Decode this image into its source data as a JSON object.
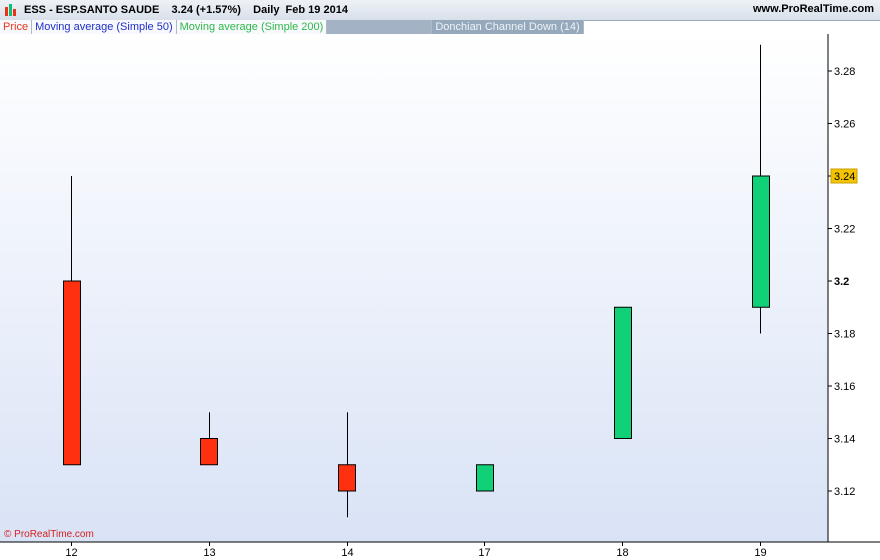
{
  "header": {
    "title": "ESS - ESP.SANTO SAUDE    3.24 (+1.57%)    Daily  Feb 19 2014",
    "site": "www.ProRealTime.com"
  },
  "legend": [
    {
      "label": "Price",
      "color": "#e8341c"
    },
    {
      "label": "Moving average (Simple 50)",
      "color": "#1f2fc8"
    },
    {
      "label": "Moving average (Simple 200)",
      "color": "#2fb84a"
    },
    {
      "label": "Donchian Channel Down (14)",
      "color": "#eef3f8"
    }
  ],
  "watermark": "© ProRealTime.com",
  "last_price_label": "3.24",
  "colors": {
    "up": "#10d078",
    "down": "#ff3010",
    "badge": "#f4c400"
  },
  "chart_data": {
    "type": "candlestick",
    "title": "",
    "xlabel": "",
    "ylabel": "",
    "x_ticks": [
      "12",
      "13",
      "14",
      "17",
      "18",
      "19"
    ],
    "y_ticks": [
      3.12,
      3.14,
      3.16,
      3.18,
      3.2,
      3.22,
      3.24,
      3.26,
      3.28
    ],
    "y_tick_labels": [
      "3.12",
      "3.14",
      "3.16",
      "3.18",
      "3.2",
      "3.22",
      "3.24",
      "3.26",
      "3.28"
    ],
    "ylim": [
      3.1,
      3.3
    ],
    "grid": false,
    "candles": [
      {
        "x": "12",
        "open": 3.2,
        "high": 3.24,
        "low": 3.13,
        "close": 3.13
      },
      {
        "x": "13",
        "open": 3.14,
        "high": 3.15,
        "low": 3.13,
        "close": 3.13
      },
      {
        "x": "14",
        "open": 3.13,
        "high": 3.15,
        "low": 3.11,
        "close": 3.12
      },
      {
        "x": "17",
        "open": 3.12,
        "high": 3.13,
        "low": 3.12,
        "close": 3.13
      },
      {
        "x": "18",
        "open": 3.14,
        "high": 3.19,
        "low": 3.14,
        "close": 3.19
      },
      {
        "x": "19",
        "open": 3.19,
        "high": 3.29,
        "low": 3.18,
        "close": 3.24
      }
    ]
  }
}
